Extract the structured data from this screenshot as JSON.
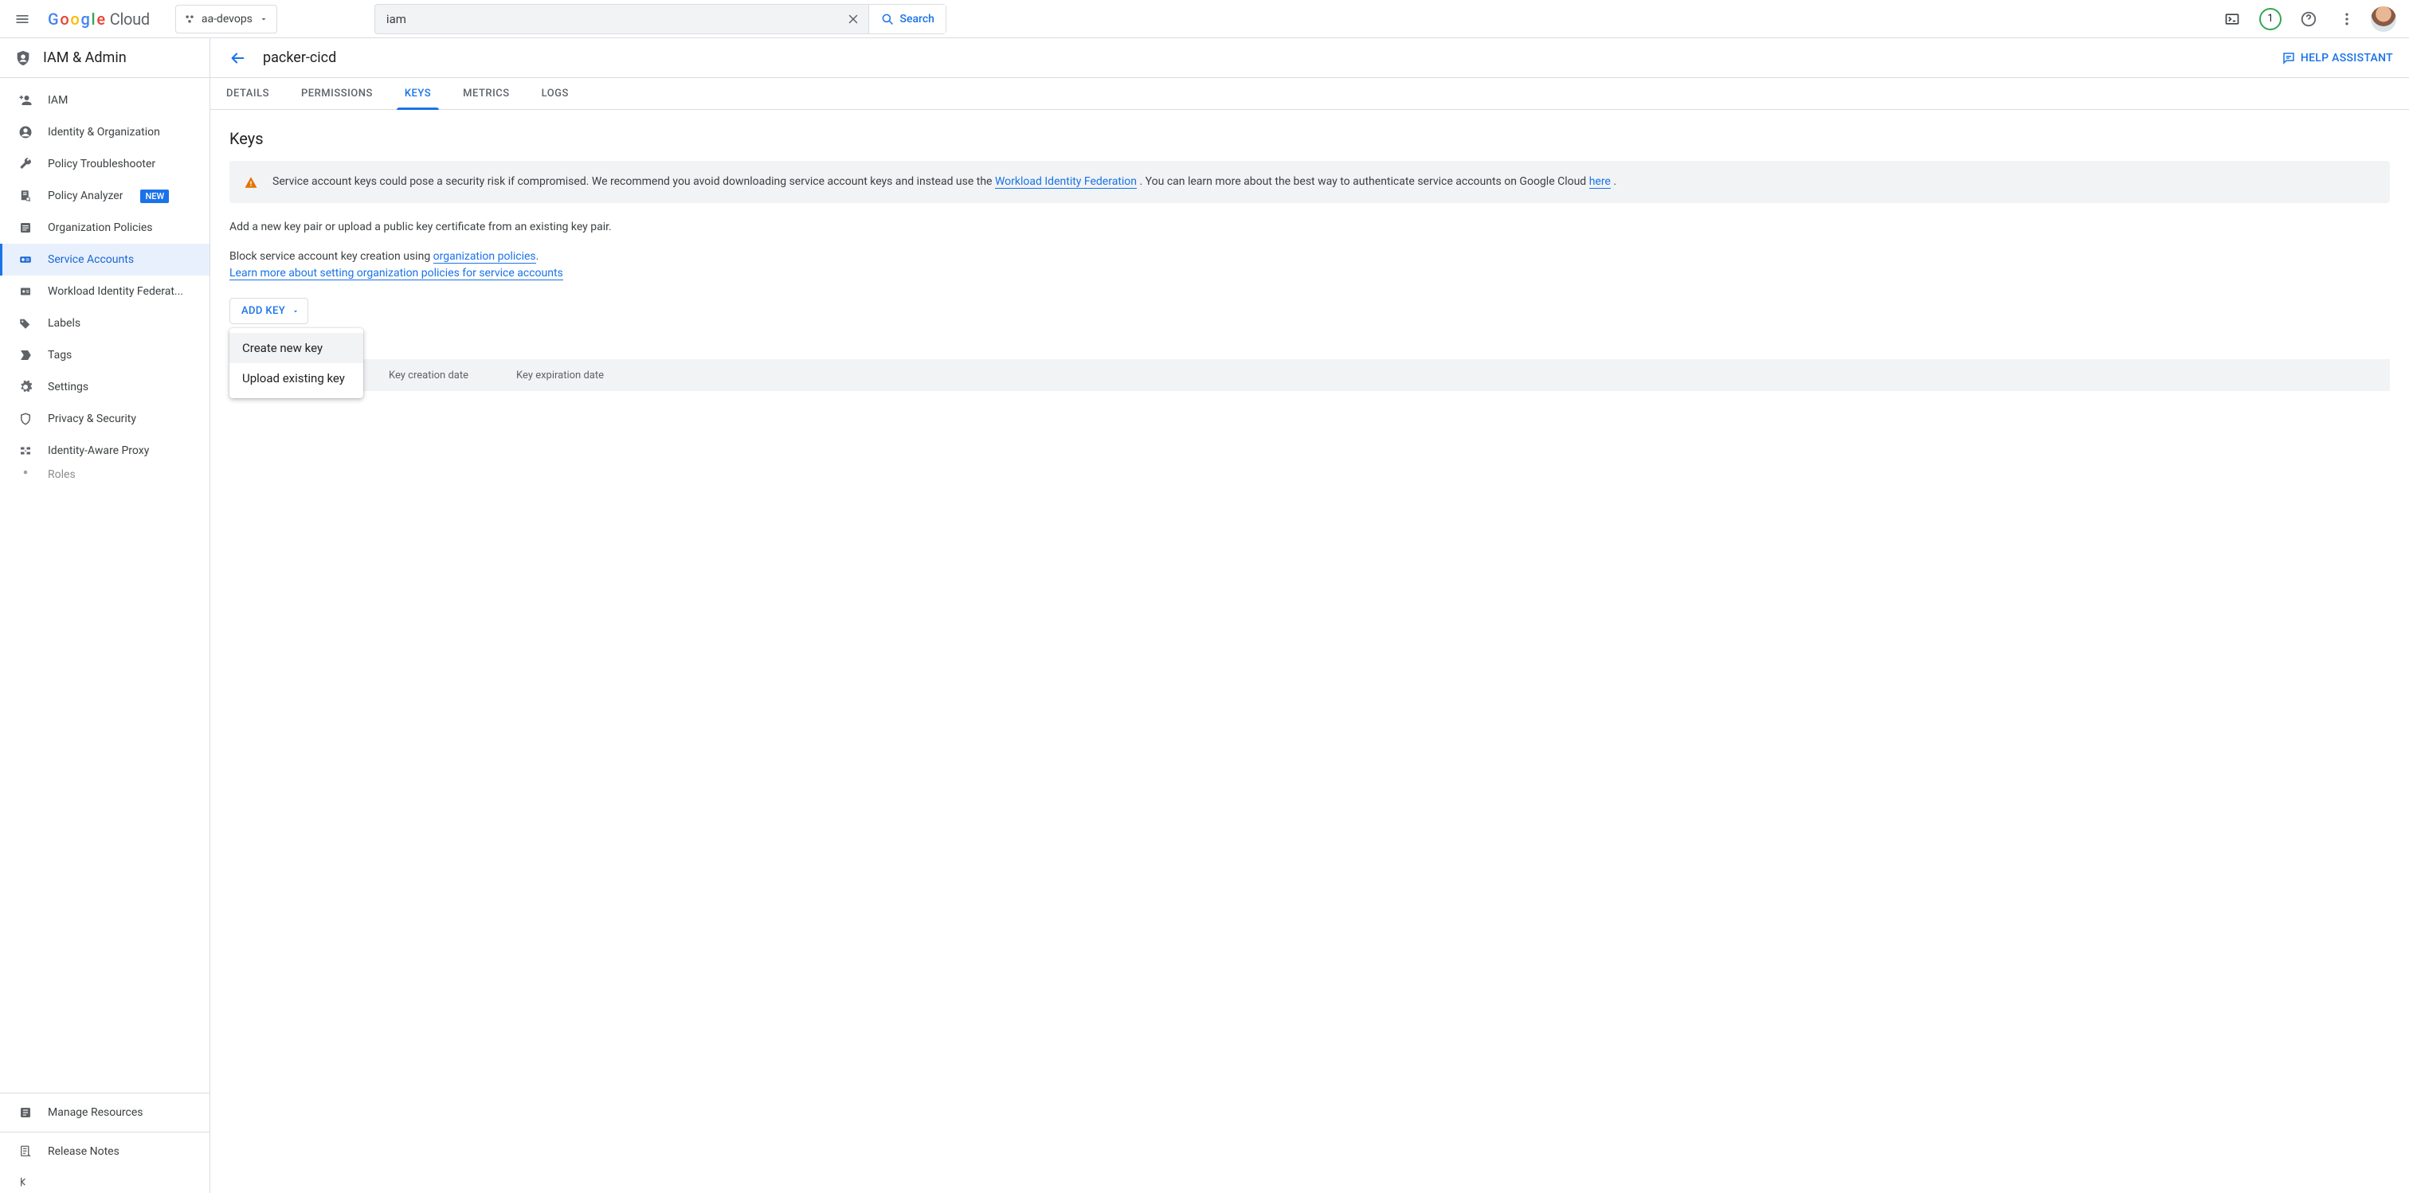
{
  "product": {
    "name": "Google",
    "suffix": "Cloud"
  },
  "project_picker": {
    "name": "aa-devops"
  },
  "search": {
    "value": "iam",
    "button": "Search"
  },
  "badge": {
    "count": "1"
  },
  "sidebar": {
    "title": "IAM & Admin",
    "items": [
      {
        "label": "IAM"
      },
      {
        "label": "Identity & Organization"
      },
      {
        "label": "Policy Troubleshooter"
      },
      {
        "label": "Policy Analyzer",
        "new": "NEW"
      },
      {
        "label": "Organization Policies"
      },
      {
        "label": "Service Accounts",
        "active": true
      },
      {
        "label": "Workload Identity Federat..."
      },
      {
        "label": "Labels"
      },
      {
        "label": "Tags"
      },
      {
        "label": "Settings"
      },
      {
        "label": "Privacy & Security"
      },
      {
        "label": "Identity-Aware Proxy"
      },
      {
        "label": "Roles"
      }
    ],
    "manage": "Manage Resources",
    "release": "Release Notes"
  },
  "page": {
    "title": "packer-cicd",
    "help": "HELP ASSISTANT",
    "tabs": [
      "DETAILS",
      "PERMISSIONS",
      "KEYS",
      "METRICS",
      "LOGS"
    ],
    "active_tab": 2,
    "section_title": "Keys",
    "alert": {
      "pre": "Service account keys could pose a security risk if compromised. We recommend you avoid downloading service account keys and instead use the ",
      "link1": "Workload Identity Federation",
      "mid": " . You can learn more about the best way to authenticate service accounts on Google Cloud ",
      "link2": "here",
      "post": " ."
    },
    "text1": "Add a new key pair or upload a public key certificate from an existing key pair.",
    "text2_pre": "Block service account key creation using ",
    "text2_link": "organization policies",
    "text2_post": ".",
    "text3": "Learn more about setting organization policies for service accounts",
    "add_key": "ADD KEY",
    "menu": [
      "Create new key",
      "Upload existing key"
    ],
    "columns": [
      "Key creation date",
      "Key expiration date"
    ]
  }
}
